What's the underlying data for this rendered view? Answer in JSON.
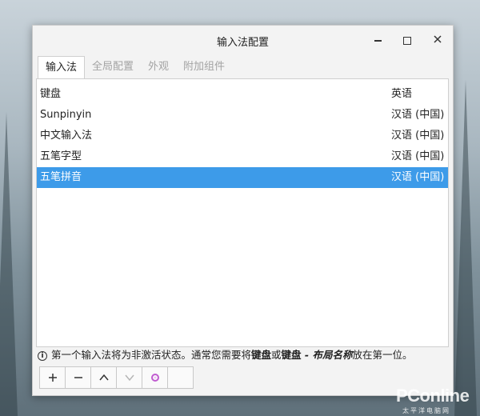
{
  "window": {
    "title": "输入法配置"
  },
  "tabs": [
    {
      "label": "输入法",
      "active": true
    },
    {
      "label": "全局配置",
      "active": false
    },
    {
      "label": "外观",
      "active": false
    },
    {
      "label": "附加组件",
      "active": false
    }
  ],
  "list": {
    "header": {
      "name": "键盘",
      "language": "英语"
    },
    "rows": [
      {
        "name": "Sunpinyin",
        "language": "汉语 (中国)"
      },
      {
        "name": "中文输入法",
        "language": "汉语 (中国)"
      },
      {
        "name": "五笔字型",
        "language": "汉语 (中国)"
      },
      {
        "name": "五笔拼音",
        "language": "汉语 (中国)",
        "selected": true
      }
    ]
  },
  "info": {
    "part1": "第一个输入法将为非激活状态。通常您需要将",
    "bold1": "键盘",
    "part2": "或",
    "bold2": "键盘",
    "italic_bold": " - 布局名称",
    "part3": "放在第一位。"
  },
  "toolbar": {
    "add": "+",
    "remove": "−"
  },
  "watermark": {
    "brand": "PConline",
    "sub": "太平洋电脑网"
  },
  "colors": {
    "selection": "#3d9be9",
    "accent_icon": "#c05bd0"
  }
}
